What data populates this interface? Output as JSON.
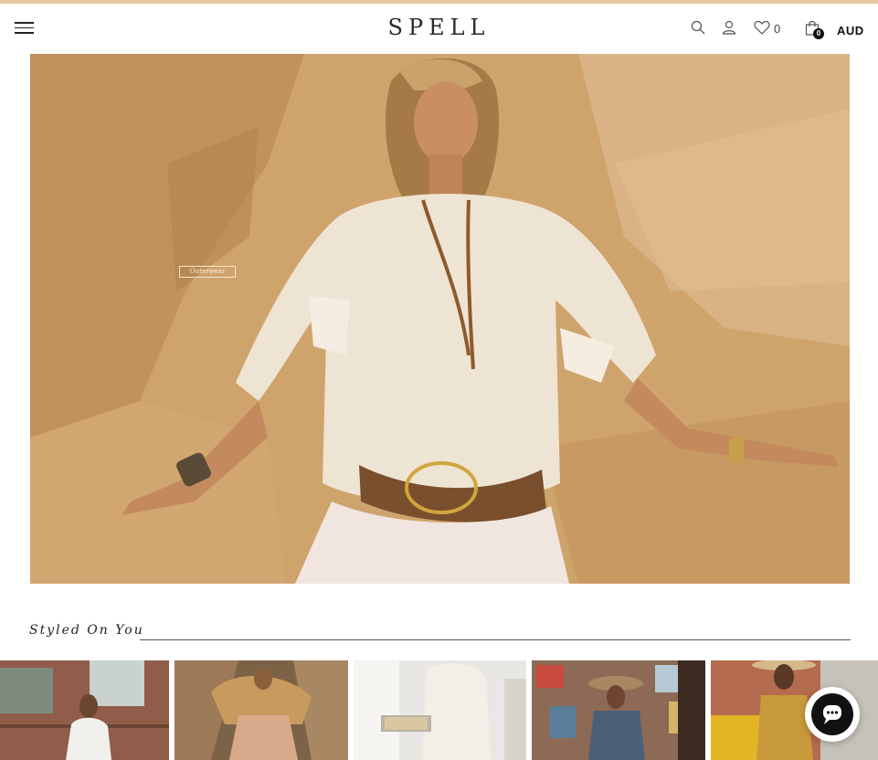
{
  "brand": {
    "logo_text": "SPELL"
  },
  "header": {
    "menu_icon": "hamburger-icon",
    "search_icon": "search-icon",
    "account_icon": "user-icon",
    "wishlist_icon": "heart-icon",
    "wishlist_count": "0",
    "cart_icon": "shopping-bag-icon",
    "cart_count": "0",
    "currency": "AUD"
  },
  "hero": {
    "tag_label": "Outerwear"
  },
  "styled_section": {
    "title": "Styled On You"
  },
  "chat": {
    "icon": "chat-icon"
  },
  "colors": {
    "accent_strip": "#e8c9a3",
    "text": "#222222",
    "hero_sand": "#c99a62"
  }
}
